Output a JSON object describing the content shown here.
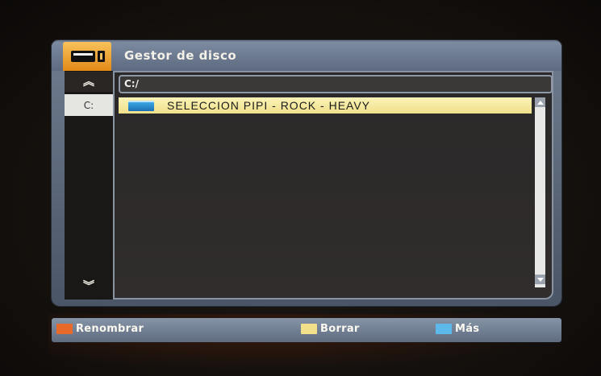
{
  "window": {
    "title": "Gestor de disco"
  },
  "drives": {
    "selected_label": "C:"
  },
  "path": {
    "value": "C:/"
  },
  "files": [
    {
      "name": "SELECCION PIPI - ROCK - HEAVY",
      "icon": "folder-icon",
      "selected": true
    }
  ],
  "nav_icons": {
    "up": "double-chevron-up-icon",
    "down": "double-chevron-down-icon"
  },
  "footer": {
    "keys": [
      {
        "label": "Renombrar",
        "color": "#e86a2a"
      },
      {
        "label": "Borrar",
        "color": "#f3e08a"
      },
      {
        "label": "Más",
        "color": "#5cb9ea"
      }
    ]
  },
  "colors": {
    "accent_tab": "#e28a18",
    "selection": "#f3e69e",
    "panel": "#5d6a80"
  }
}
